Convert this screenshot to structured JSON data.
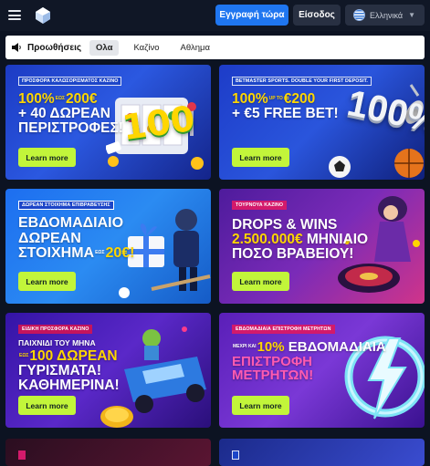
{
  "header": {
    "register_label": "Εγγραφή τώρα",
    "login_label": "Είσοδος",
    "language_label": "Ελληνικά"
  },
  "filters": {
    "title": "Προωθήσεις",
    "tabs": [
      "Ολα",
      "Καζίνο",
      "Αθλημα"
    ],
    "active_tab": "Ολα"
  },
  "promos": [
    {
      "badge": "ΠΡΟΣΦΟΡΑ ΚΑΛΩΣΟΡΙΣΜΑΤΟΣ ΚΑΖΙΝΟ",
      "line1_yellow": "100%",
      "line1_small": "ΕΩΣ",
      "line1_end": "200€",
      "line2": "+ 40 ΔΩΡΕΑΝ",
      "line3": "ΠΕΡΙΣΤΡΟΦΕΣ!",
      "art_text": "100",
      "cta": "Learn more"
    },
    {
      "badge": "BETMASTER SPORTS. DOUBLE YOUR FIRST DEPOSIT.",
      "line1_yellow": "100%",
      "line1_small": "UP TO",
      "line1_end": "€200",
      "line2": "+ €5 FREE BET!",
      "art_text": "100%",
      "cta": "Learn more"
    },
    {
      "badge": "ΔΩΡΕΑΝ ΣΤΟΙΧΗΜΑ ΕΠΙΒΡΑΒΕΥΣΗΣ",
      "line1": "ΕΒΔΟΜΑΔΙΑΙΟ",
      "line2": "ΔΩΡΕΑΝ",
      "line3_start": "ΣΤΟΙΧΗΜΑ",
      "line3_small": "ΕΩΣ",
      "line3_yellow": "20€!",
      "cta": "Learn more"
    },
    {
      "badge": "ΤΟΥΡΝΟΥΑ ΚΑΖΙΝΟ",
      "line1": "DROPS & WINS",
      "line2_yellow": "2.500.000€",
      "line2_end": "ΜΗΝΙΑΙΟ",
      "line3": "ΠΟΣΟ ΒΡΑΒΕΙΟΥ!",
      "cta": "Learn more"
    },
    {
      "badge": "ΕΙΔΙΚΗ ΠΡΟΣΦΟΡΑ ΚΑΖΙΝΟ",
      "line1": "ΠΑΙΧΝΙΔΙ ΤΟΥ ΜΗΝΑ",
      "line2_small": "ΕΩΣ",
      "line2_yellow": "100 ΔΩΡΕΑΝ",
      "line3": "ΓΥΡΙΣΜΑΤΑ!",
      "line4": "ΚΑΘΗΜΕΡΙΝΑ!",
      "cta": "Learn more"
    },
    {
      "badge": "ΕΒΔΟΜΑΔΙΑΙΑ ΕΠΙΣΤΡΟΦΗ ΜΕΤΡΗΤΩΝ",
      "line1_small": "ΜΕΧΡΙ ΚΑΙ",
      "line1_yellow": "10%",
      "line1_end": "ΕΒΔΟΜΑΔΙΑΙΑ",
      "line2": "ΕΠΙΣΤΡΟΦΗ",
      "line3": "ΜΕΤΡΗΤΩΝ!",
      "cta": "Learn more"
    }
  ],
  "colors": {
    "accent_blue": "#1f76f0",
    "cta_lime": "#c2f53a",
    "highlight_yellow": "#ffd600"
  }
}
